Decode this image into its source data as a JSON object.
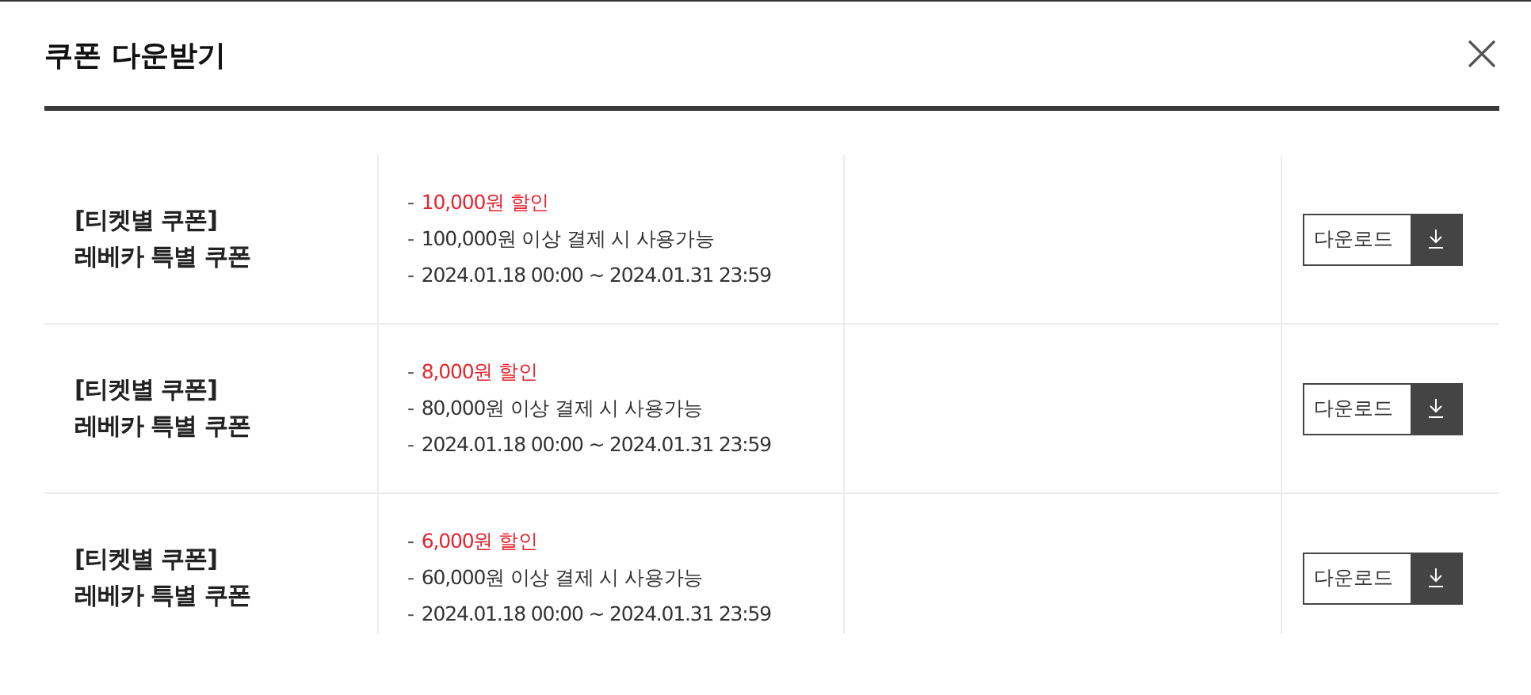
{
  "title": "쿠폰 다운받기",
  "coupons": [
    {
      "name_lines": [
        "[티켓별 쿠폰]",
        "레베카 특별 쿠폰"
      ],
      "details": [
        {
          "marker": "-",
          "text": "10,000원 할인",
          "kind": "discount"
        },
        {
          "marker": "-",
          "text": "100,000원 이상 결제 시 사용가능",
          "kind": "plain"
        },
        {
          "marker": "-",
          "text": "2024.01.18 00:00 ~ 2024.01.31 23:59",
          "kind": "plain"
        }
      ],
      "button": "다운로드"
    },
    {
      "name_lines": [
        "[티켓별 쿠폰]",
        "레베카 특별 쿠폰"
      ],
      "details": [
        {
          "marker": "-",
          "text": "8,000원 할인",
          "kind": "discount"
        },
        {
          "marker": "-",
          "text": "80,000원 이상 결제 시 사용가능",
          "kind": "plain"
        },
        {
          "marker": "-",
          "text": "2024.01.18 00:00 ~ 2024.01.31 23:59",
          "kind": "plain"
        }
      ],
      "button": "다운로드"
    },
    {
      "name_lines": [
        "[티켓별 쿠폰]",
        "레베카 특별 쿠폰"
      ],
      "details": [
        {
          "marker": "-",
          "text": "6,000원 할인",
          "kind": "discount"
        },
        {
          "marker": "-",
          "text": "60,000원 이상 결제 시 사용가능",
          "kind": "plain"
        },
        {
          "marker": "-",
          "text": "2024.01.18 00:00 ~ 2024.01.31 23:59",
          "kind": "plain"
        }
      ],
      "button": "다운로드"
    }
  ]
}
